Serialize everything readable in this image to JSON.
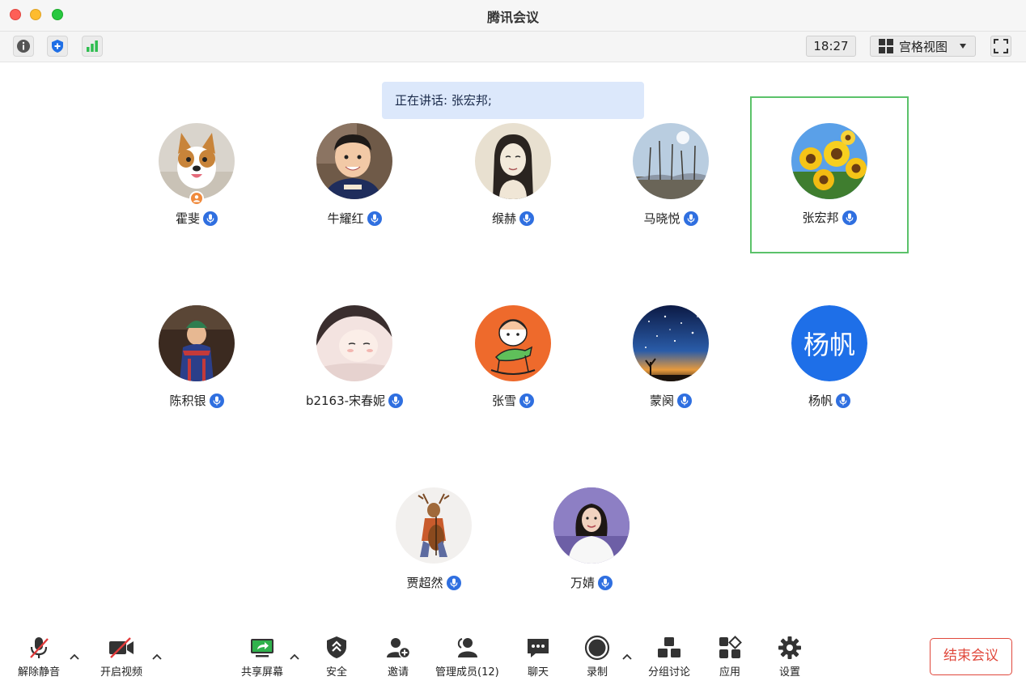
{
  "window": {
    "title": "腾讯会议"
  },
  "toolbar": {
    "icons": [
      "info-icon",
      "shield-icon",
      "signal-icon"
    ],
    "time": "18:27",
    "view_label": "宫格视图",
    "view_icon": "grid-icon",
    "fullscreen_icon": "fullscreen-icon"
  },
  "speaker_banner": {
    "text": "正在讲话: 张宏邦;"
  },
  "participants": [
    {
      "name": "霍斐",
      "avatar": "corgi-dog-photo",
      "host": true
    },
    {
      "name": "牛耀红",
      "avatar": "boy-photo"
    },
    {
      "name": "缑赫",
      "avatar": "girl-sketch"
    },
    {
      "name": "马晓悦",
      "avatar": "winter-trees-photo"
    },
    {
      "name": "张宏邦",
      "avatar": "sunflowers-photo",
      "speaking": true
    },
    {
      "name": "陈积银",
      "avatar": "child-costume-photo"
    },
    {
      "name": "b2163-宋春妮",
      "avatar": "anime-girl-drawing"
    },
    {
      "name": "张雪",
      "avatar": "cartoon-rocking-horse"
    },
    {
      "name": "蒙阕",
      "avatar": "starry-sky-photo"
    },
    {
      "name": "杨帆",
      "avatar_text": "杨帆",
      "avatar_color": "#1e6fe8"
    },
    {
      "name": "贾超然",
      "avatar": "deer-cello-illustration"
    },
    {
      "name": "万婧",
      "avatar": "woman-portrait-photo"
    }
  ],
  "controls": {
    "unmute": "解除静音",
    "start_video": "开启视频",
    "share_screen": "共享屏幕",
    "security": "安全",
    "invite": "邀请",
    "manage_members": "管理成员(12)",
    "chat": "聊天",
    "record": "录制",
    "breakout": "分组讨论",
    "apps": "应用",
    "settings": "设置",
    "end_meeting": "结束会议"
  },
  "colors": {
    "accent": "#2f6fe0",
    "active_border": "#5bc26a",
    "end_button": "#e0483c",
    "banner_bg": "#dce8fb"
  }
}
